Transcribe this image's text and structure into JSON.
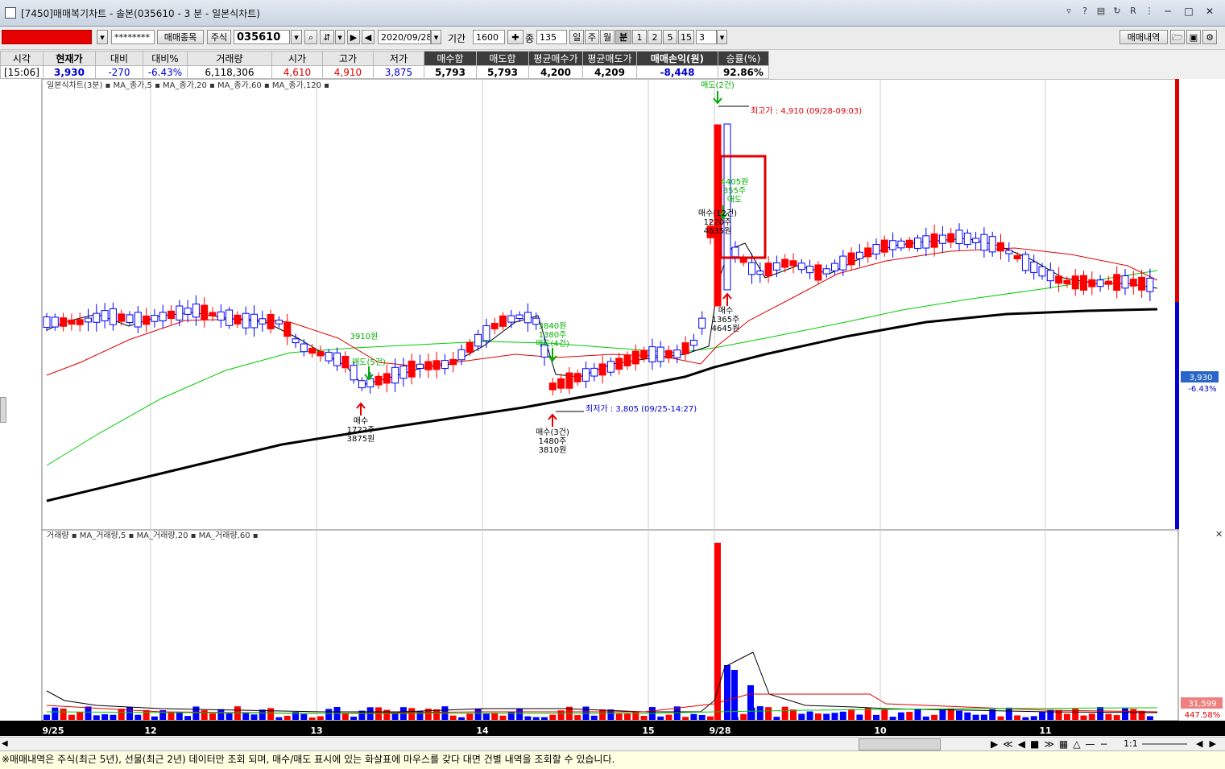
{
  "window": {
    "title": "[7450]매매복기차트 - 솔본(035610 - 3 분 - 일본식차트)",
    "icons": [
      "help-icon",
      "question-icon",
      "layout-icon",
      "refresh-icon",
      "pin-icon",
      "minimize-icon",
      "restore-icon",
      "close-icon"
    ]
  },
  "toolbar": {
    "password": "********",
    "trade_list_btn": "매매종목",
    "market_label": "주식",
    "code": "035610",
    "date": "2020/09/28",
    "period_label": "기간",
    "period_value": "1600",
    "count_label": "종",
    "count_value": "135",
    "intervals": [
      "일",
      "주",
      "월",
      "분",
      "1",
      "2",
      "5",
      "15"
    ],
    "selected_interval": "분",
    "minute_value": "3",
    "trade_history_btn": "매매내역"
  },
  "info": {
    "headers": [
      "시각",
      "현재가",
      "대비",
      "대비%",
      "거래량",
      "시가",
      "고가",
      "저가",
      "매수합",
      "매도합",
      "평균매수가",
      "평균매도가",
      "매매손익(원)",
      "승률(%)"
    ],
    "values": [
      "[15:06]",
      "3,930",
      "-270",
      "-6.43%",
      "6,118,306",
      "4,610",
      "4,910",
      "3,875",
      "5,793",
      "5,793",
      "4,200",
      "4,209",
      "-8,448",
      "92.86%"
    ]
  },
  "price_chart": {
    "legend": "일본식차트(3분) ▪ MA_종가,5 ▪ MA_종가,20 ▪ MA_종가,60 ▪ MA_종가,120 ▪",
    "high_label": "최고가 : 4,910 (09/28-09:03)",
    "low_label": "최저가 : 3,805 (09/25-14:27)",
    "current_price": "3,930",
    "current_pct": "-6.43%",
    "annotations": [
      {
        "text": "매도(2건)",
        "color": "#00b000"
      },
      {
        "text": "매수(12건)",
        "color": "#000"
      },
      {
        "text": "1220주",
        "color": "#000"
      },
      {
        "text": "4635원",
        "color": "#000"
      },
      {
        "text": "매수",
        "color": "#000"
      },
      {
        "text": "1365주",
        "color": "#000"
      },
      {
        "text": "4645원",
        "color": "#000"
      },
      {
        "text": "매수",
        "color": "#000"
      },
      {
        "text": "1722주",
        "color": "#000"
      },
      {
        "text": "3875원",
        "color": "#000"
      },
      {
        "text": "매수(3건)",
        "color": "#000"
      },
      {
        "text": "1480주",
        "color": "#000"
      },
      {
        "text": "3810원",
        "color": "#000"
      },
      {
        "text": "4405원",
        "color": "#00b000"
      },
      {
        "text": "355주",
        "color": "#00b000"
      },
      {
        "text": "매도",
        "color": "#00b000"
      },
      {
        "text": "3910원",
        "color": "#00b000"
      },
      {
        "text": "매도(5건)",
        "color": "#00b000"
      },
      {
        "text": "3840원",
        "color": "#00b000"
      },
      {
        "text": "1380주",
        "color": "#00b000"
      },
      {
        "text": "매도(4건)",
        "color": "#00b000"
      }
    ]
  },
  "volume_chart": {
    "legend": "거래량 ▪ MA_거래량,5 ▪ MA_거래량,20 ▪ MA_거래량,60 ▪",
    "current_volume": "31,599",
    "current_pct": "447.58%"
  },
  "x_axis": [
    "9/25",
    "12",
    "13",
    "14",
    "15",
    "9/28",
    "10",
    "11"
  ],
  "scroll": {
    "zoom": "1:1"
  },
  "status": "※매매내역은 주식(최근 5년), 선물(최근 2년) 데이터만 조회 되며, 매수/매도 표시에 있는 화살표에 마우스를 갖다 대면 건별 내역을 조회할 수 있습니다.",
  "colors": {
    "up": "#ff0000",
    "down": "#0000ff",
    "ma5": "#000000",
    "ma20": "#e00000",
    "ma60": "#00cc00",
    "ma120": "#000000"
  }
}
